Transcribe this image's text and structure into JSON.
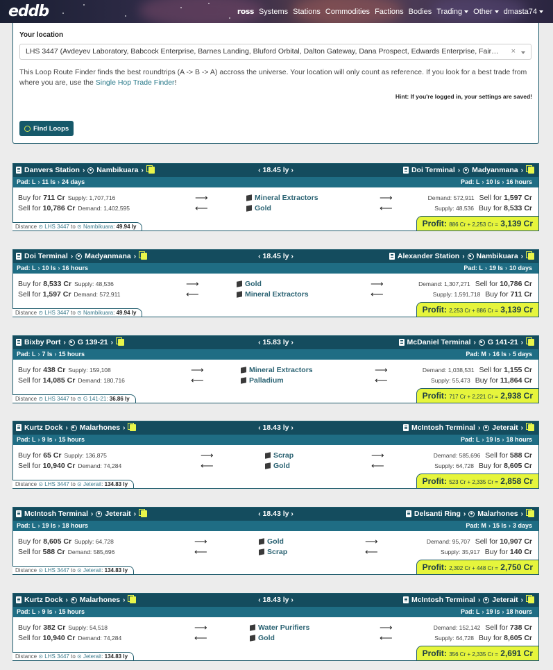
{
  "nav": {
    "logo": "eddb",
    "user_badge": "ross",
    "items": [
      "Systems",
      "Stations",
      "Commodities",
      "Factions",
      "Bodies"
    ],
    "trading": "Trading",
    "other": "Other",
    "user": "dmasta74"
  },
  "location": {
    "label": "Your location",
    "value": "LHS 3447 (Avdeyev Laboratory, Babcock Enterprise, Barnes Landing, Bluford Orbital, Dalton Gateway, Dana Prospect, Edwards Enterprise, Fair…",
    "clear": "×",
    "desc_before": "This Loop Route Finder finds the best roundtrips (A -> B -> A) accross the universe. Your location will only count as reference. If you look for a best trade from where you are, use the ",
    "desc_link": "Single Hop Trade Finder",
    "desc_after": "!",
    "hint": "Hint: If you're logged in, your settings are saved!",
    "button": "Find Loops"
  },
  "routes": [
    {
      "a": {
        "station": "Danvers Station",
        "system": "Nambikuara",
        "pad": "Pad: L",
        "ls": "11 ls",
        "age": "24 days"
      },
      "dist_ly": "18.45 ly",
      "b": {
        "station": "Doi Terminal",
        "system": "Madyanmana",
        "pad": "Pad: L",
        "ls": "10 ls",
        "age": "16 hours"
      },
      "buy": {
        "label": "Buy for",
        "price": "711 Cr",
        "stock_label": "Supply:",
        "stock": "1,707,716",
        "commodity": "Mineral Extractors",
        "dest_stock_label": "Demand:",
        "dest_stock": "572,911",
        "dest_label": "Sell for",
        "dest_price": "1,597 Cr"
      },
      "sell": {
        "label": "Sell for",
        "price": "10,786 Cr",
        "stock_label": "Demand:",
        "stock": "1,402,595",
        "commodity": "Gold",
        "dest_stock_label": "Supply:",
        "dest_stock": "48,536",
        "dest_label": "Buy for",
        "dest_price": "8,533 Cr"
      },
      "distance": {
        "label": "Distance",
        "from": "LHS 3447",
        "to_word": "to",
        "to": "Nambikuara",
        "value": "49.94 ly"
      },
      "profit": {
        "label": "Profit:",
        "calc": "886 Cr + 2,253 Cr =",
        "total": "3,139 Cr"
      }
    },
    {
      "a": {
        "station": "Doi Terminal",
        "system": "Madyanmana",
        "pad": "Pad: L",
        "ls": "10 ls",
        "age": "16 hours"
      },
      "dist_ly": "18.45 ly",
      "b": {
        "station": "Alexander Station",
        "system": "Nambikuara",
        "pad": "Pad: L",
        "ls": "19 ls",
        "age": "10 days"
      },
      "buy": {
        "label": "Buy for",
        "price": "8,533 Cr",
        "stock_label": "Supply:",
        "stock": "48,536",
        "commodity": "Gold",
        "dest_stock_label": "Demand:",
        "dest_stock": "1,307,271",
        "dest_label": "Sell for",
        "dest_price": "10,786 Cr"
      },
      "sell": {
        "label": "Sell for",
        "price": "1,597 Cr",
        "stock_label": "Demand:",
        "stock": "572,911",
        "commodity": "Mineral Extractors",
        "dest_stock_label": "Supply:",
        "dest_stock": "1,591,718",
        "dest_label": "Buy for",
        "dest_price": "711 Cr"
      },
      "distance": {
        "label": "Distance",
        "from": "LHS 3447",
        "to_word": "to",
        "to": "Nambikuara",
        "value": "49.94 ly"
      },
      "profit": {
        "label": "Profit:",
        "calc": "2,253 Cr + 886 Cr =",
        "total": "3,139 Cr"
      }
    },
    {
      "a": {
        "station": "Bixby Port",
        "system": "G 139-21",
        "pad": "Pad: L",
        "ls": "7 ls",
        "age": "15 hours"
      },
      "dist_ly": "15.83 ly",
      "b": {
        "station": "McDaniel Terminal",
        "system": "G 141-21",
        "pad": "Pad: M",
        "ls": "16 ls",
        "age": "5 days"
      },
      "buy": {
        "label": "Buy for",
        "price": "438 Cr",
        "stock_label": "Supply:",
        "stock": "159,108",
        "commodity": "Mineral Extractors",
        "dest_stock_label": "Demand:",
        "dest_stock": "1,038,531",
        "dest_label": "Sell for",
        "dest_price": "1,155 Cr"
      },
      "sell": {
        "label": "Sell for",
        "price": "14,085 Cr",
        "stock_label": "Demand:",
        "stock": "180,716",
        "commodity": "Palladium",
        "dest_stock_label": "Supply:",
        "dest_stock": "55,473",
        "dest_label": "Buy for",
        "dest_price": "11,864 Cr"
      },
      "distance": {
        "label": "Distance",
        "from": "LHS 3447",
        "to_word": "to",
        "to": "G 141-21",
        "value": "36.86 ly"
      },
      "profit": {
        "label": "Profit:",
        "calc": "717 Cr + 2,221 Cr =",
        "total": "2,938 Cr"
      }
    },
    {
      "a": {
        "station": "Kurtz Dock",
        "system": "Malarhones",
        "pad": "Pad: L",
        "ls": "9 ls",
        "age": "15 hours"
      },
      "dist_ly": "18.43 ly",
      "b": {
        "station": "McIntosh Terminal",
        "system": "Jeterait",
        "pad": "Pad: L",
        "ls": "19 ls",
        "age": "18 hours"
      },
      "buy": {
        "label": "Buy for",
        "price": "65 Cr",
        "stock_label": "Supply:",
        "stock": "136,875",
        "commodity": "Scrap",
        "dest_stock_label": "Demand:",
        "dest_stock": "585,696",
        "dest_label": "Sell for",
        "dest_price": "588 Cr"
      },
      "sell": {
        "label": "Sell for",
        "price": "10,940 Cr",
        "stock_label": "Demand:",
        "stock": "74,284",
        "commodity": "Gold",
        "dest_stock_label": "Supply:",
        "dest_stock": "64,728",
        "dest_label": "Buy for",
        "dest_price": "8,605 Cr"
      },
      "distance": {
        "label": "Distance",
        "from": "LHS 3447",
        "to_word": "to",
        "to": "Jeterait",
        "value": "134.83 ly"
      },
      "profit": {
        "label": "Profit:",
        "calc": "523 Cr + 2,335 Cr =",
        "total": "2,858 Cr"
      }
    },
    {
      "a": {
        "station": "McIntosh Terminal",
        "system": "Jeterait",
        "pad": "Pad: L",
        "ls": "19 ls",
        "age": "18 hours"
      },
      "dist_ly": "18.43 ly",
      "b": {
        "station": "Delsanti Ring",
        "system": "Malarhones",
        "pad": "Pad: M",
        "ls": "15 ls",
        "age": "3 days"
      },
      "buy": {
        "label": "Buy for",
        "price": "8,605 Cr",
        "stock_label": "Supply:",
        "stock": "64,728",
        "commodity": "Gold",
        "dest_stock_label": "Demand:",
        "dest_stock": "95,707",
        "dest_label": "Sell for",
        "dest_price": "10,907 Cr"
      },
      "sell": {
        "label": "Sell for",
        "price": "588 Cr",
        "stock_label": "Demand:",
        "stock": "585,696",
        "commodity": "Scrap",
        "dest_stock_label": "Supply:",
        "dest_stock": "35,917",
        "dest_label": "Buy for",
        "dest_price": "140 Cr"
      },
      "distance": {
        "label": "Distance",
        "from": "LHS 3447",
        "to_word": "to",
        "to": "Jeterait",
        "value": "134.83 ly"
      },
      "profit": {
        "label": "Profit:",
        "calc": "2,302 Cr + 448 Cr =",
        "total": "2,750 Cr"
      }
    },
    {
      "a": {
        "station": "Kurtz Dock",
        "system": "Malarhones",
        "pad": "Pad: L",
        "ls": "9 ls",
        "age": "15 hours"
      },
      "dist_ly": "18.43 ly",
      "b": {
        "station": "McIntosh Terminal",
        "system": "Jeterait",
        "pad": "Pad: L",
        "ls": "19 ls",
        "age": "18 hours"
      },
      "buy": {
        "label": "Buy for",
        "price": "382 Cr",
        "stock_label": "Supply:",
        "stock": "54,518",
        "commodity": "Water Purifiers",
        "dest_stock_label": "Demand:",
        "dest_stock": "152,142",
        "dest_label": "Sell for",
        "dest_price": "738 Cr"
      },
      "sell": {
        "label": "Sell for",
        "price": "10,940 Cr",
        "stock_label": "Demand:",
        "stock": "74,284",
        "commodity": "Gold",
        "dest_stock_label": "Supply:",
        "dest_stock": "64,728",
        "dest_label": "Buy for",
        "dest_price": "8,605 Cr"
      },
      "distance": {
        "label": "Distance",
        "from": "LHS 3447",
        "to_word": "to",
        "to": "Jeterait",
        "value": "134.83 ly"
      },
      "profit": {
        "label": "Profit:",
        "calc": "356 Cr + 2,335 Cr =",
        "total": "2,691 Cr"
      }
    }
  ]
}
